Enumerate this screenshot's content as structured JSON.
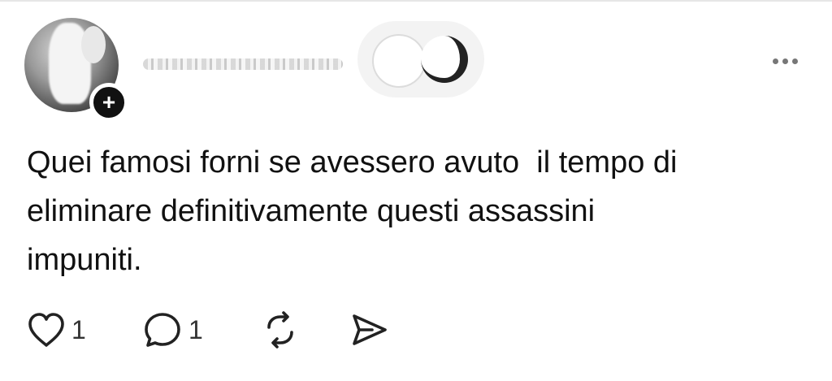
{
  "post": {
    "author": {
      "username": "",
      "follow_label": "+"
    },
    "text": "Quei famosi forni se avessero avuto  il tempo di\neliminare definitivamente questi assassini\nimpuniti.",
    "actions": {
      "likes": "1",
      "replies": "1"
    },
    "icons": {
      "like": "heart-icon",
      "reply": "comment-icon",
      "repost": "repost-icon",
      "share": "send-icon",
      "more": "more-horizontal-icon"
    }
  }
}
